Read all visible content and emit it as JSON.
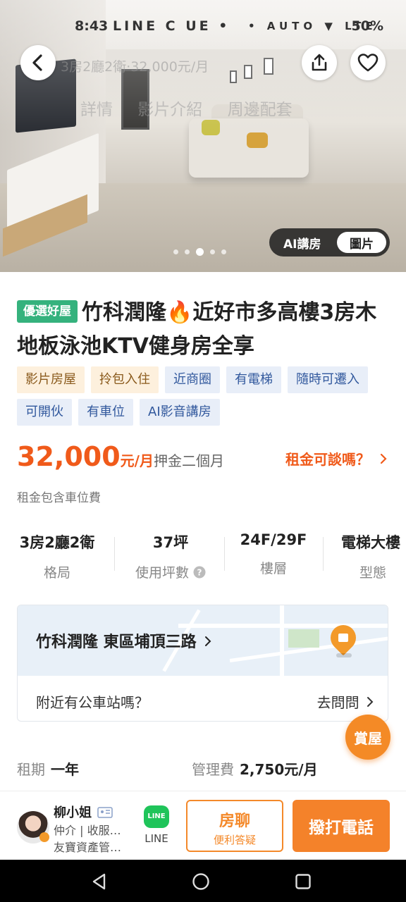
{
  "status_bar": {
    "time": "8:43",
    "left_icons": "LINE C UE •",
    "right_icons": "• AUTO ▼ LTE",
    "battery": "50%"
  },
  "hero": {
    "ghost_title": "3房2廳2衛·32,000元/月",
    "ghost_tabs": "詳情 影片介紹 周邊配套",
    "ai_label": "AI講房",
    "photo_label": "圖片",
    "carousel_active_index": 2,
    "carousel_total": 5
  },
  "listing": {
    "badge": "優選好屋",
    "title": "竹科潤隆🔥近好市多高樓3房木地板泳池KTV健身房全享",
    "tags_orange": [
      "影片房屋",
      "拎包入住"
    ],
    "tags_blue": [
      "近商圈",
      "有電梯",
      "隨時可遷入",
      "可開伙",
      "有車位",
      "AI影音講房"
    ],
    "price": "32,000",
    "price_unit": "元/月",
    "deposit": "押金二個月",
    "negotiate": "租金可談嗎？",
    "rent_note": "租金包含車位費"
  },
  "specs": [
    {
      "value": "3房2廳2衛",
      "label": "格局"
    },
    {
      "value": "37坪",
      "label": "使用坪數"
    },
    {
      "value": "24F/29F",
      "label": "樓層"
    },
    {
      "value": "電梯大樓",
      "label": "型態"
    }
  ],
  "map": {
    "address": "竹科潤隆 東區埔頂三路",
    "question": "附近有公車站嗎？",
    "ask": "去問問"
  },
  "fab": "賞屋",
  "terms": {
    "lease_label": "租期",
    "lease_value": "一年",
    "fee_label": "管理費",
    "fee_value": "2,750元/月"
  },
  "agent": {
    "name": "柳小姐",
    "role": "仲介 | 收服…",
    "company": "友寶資產管…"
  },
  "actions": {
    "line_logo": "LINE",
    "line_label": "LINE",
    "chat_main": "房聊",
    "chat_sub": "便利答疑",
    "call": "撥打電話"
  },
  "colors": {
    "accent": "#f4822a",
    "price": "#f05a1a",
    "badge_green": "#35b27d"
  }
}
